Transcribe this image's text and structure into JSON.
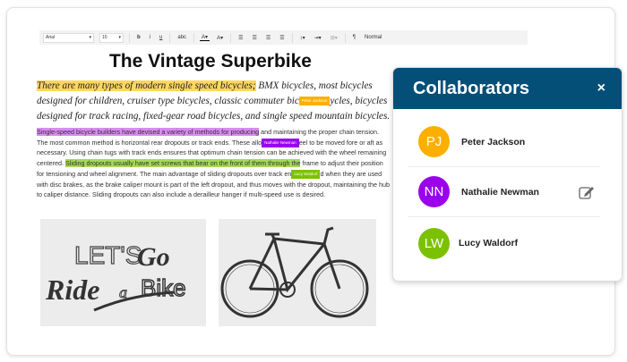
{
  "toolbar": {
    "font": "Arial",
    "size": "10",
    "bold": "b",
    "italic": "i",
    "underline": "u",
    "strike": "abc",
    "style": "Normal"
  },
  "document": {
    "title": "The Vintage Superbike",
    "intro": {
      "highlight": "There are many types of  modern single speed bicycles;",
      "p1": " BMX bicycles, most bicycles designed for children, cruiser type bicycles, classic commuter bic",
      "p2": "ycles, bicycles designed for track racing, fixed-gear road bicycles, and single speed mountain bicycles."
    },
    "body": {
      "hl1": "Single-speed bicycle builders have devised a variety of methods for producing",
      "t1": " and maintaining the proper chain tension. The most common method is horizontal rear dropouts or track ends. These allo",
      "t2": "eel to be moved fore or aft as necessary. Using chain tugs with track ends ensures that optimum chain tension can be achieved with the wheel remaining centered. ",
      "hl2": "Sliding dropouts usually have set screws that bear on the front of them through the",
      "t3": " frame to adjust their position for tensioning and wheel alignment. The main advantage of sliding dropouts over track en",
      "t4": "d when they are used with disc brakes, as the brake caliper mount is part of the left dropout, and thus moves with the dropout, maintaining the hub to caliper distance. Sliding dropouts can also include a derailleur hanger if multi-speed use is desired."
    },
    "images": {
      "lettering": "LET'S GO Ride a Bike"
    }
  },
  "cursors": {
    "peter": "Peter Jackson",
    "nathalie": "Nathalie Newman",
    "lucy": "Lucy Waldorf"
  },
  "panel": {
    "title": "Collaborators",
    "close": "×",
    "people": [
      {
        "initials": "PJ",
        "name": "Peter Jackson",
        "color": "#fbb000"
      },
      {
        "initials": "NN",
        "name": "Nathalie Newman",
        "color": "#9b00ec"
      },
      {
        "initials": "LW",
        "name": "Lucy Waldorf",
        "color": "#7cc100"
      }
    ]
  },
  "colors": {
    "header": "#044f78",
    "highlight_yellow": "#fdd663",
    "highlight_purple": "#d98cf0",
    "highlight_green": "#a5d955"
  }
}
